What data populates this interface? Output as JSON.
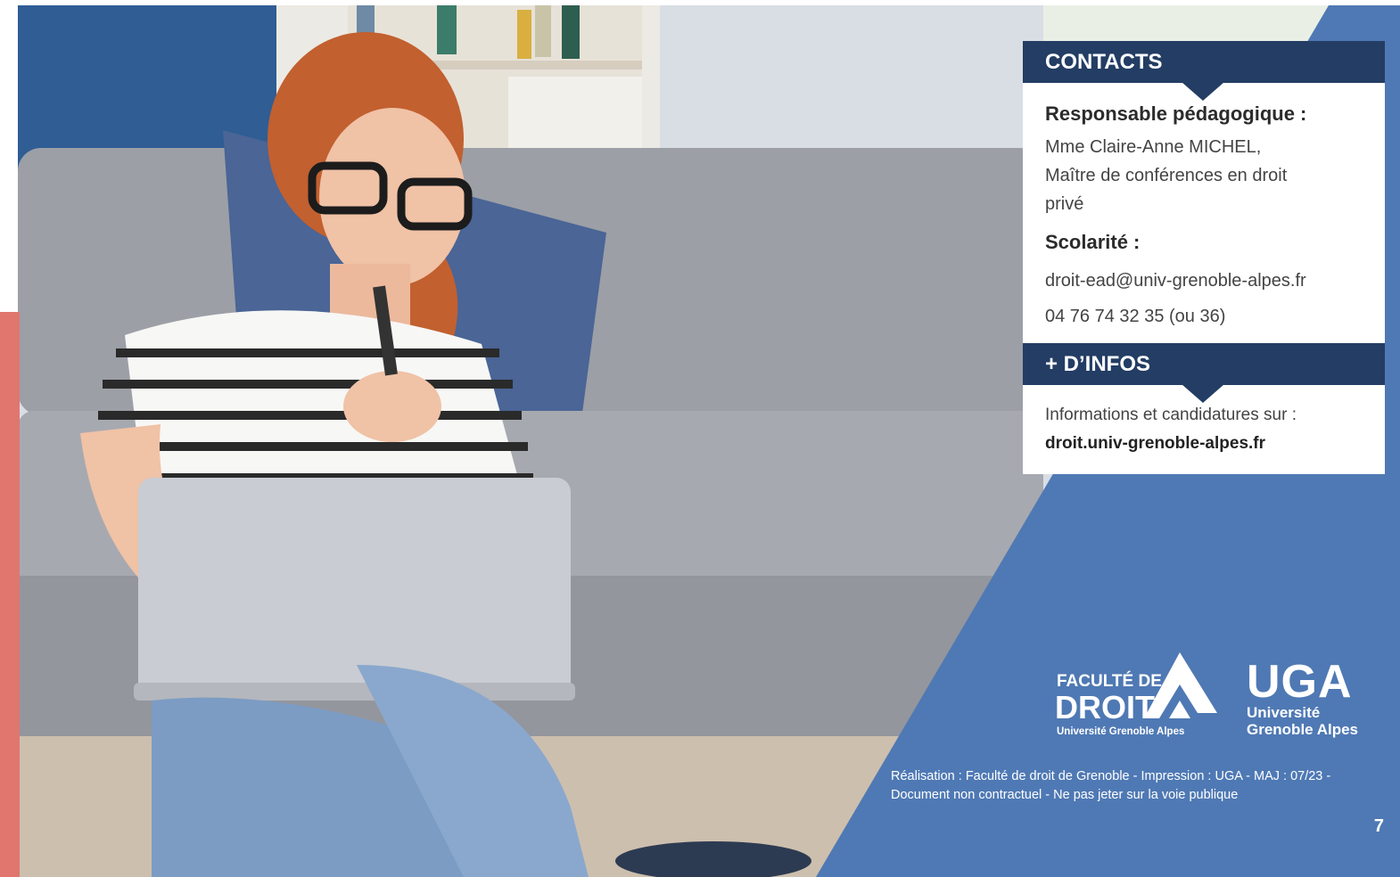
{
  "contacts": {
    "heading": "CONTACTS",
    "responsable_label": "Responsable pédagogique :",
    "responsable_lines": [
      "Mme Claire-Anne MICHEL,",
      "Maître de conférences en droit",
      "privé"
    ],
    "scolarite_label": "Scolarité :",
    "email": "droit-ead@univ-grenoble-alpes.fr",
    "phone": "04 76 74 32 35 (ou 36)"
  },
  "infos": {
    "heading": "+ D’INFOS",
    "text": "Informations et candidatures sur :",
    "link": "droit.univ-grenoble-alpes.fr"
  },
  "logos": {
    "faculte": {
      "line1": "FACULTÉ DE",
      "line2": "DROIT",
      "line3": "Université Grenoble Alpes"
    },
    "uga": {
      "line1": "UGA",
      "line2": "Université",
      "line3": "Grenoble Alpes"
    }
  },
  "footer": {
    "line1": "Réalisation : Faculté de droit de Grenoble - Impression : UGA - MAJ : 07/23 -",
    "line2": "Document non contractuel - Ne pas jeter sur la voie publique"
  },
  "page_number": "7",
  "colors": {
    "navy": "#233d64",
    "blue": "#4f79b4",
    "coral": "#e0766e"
  }
}
